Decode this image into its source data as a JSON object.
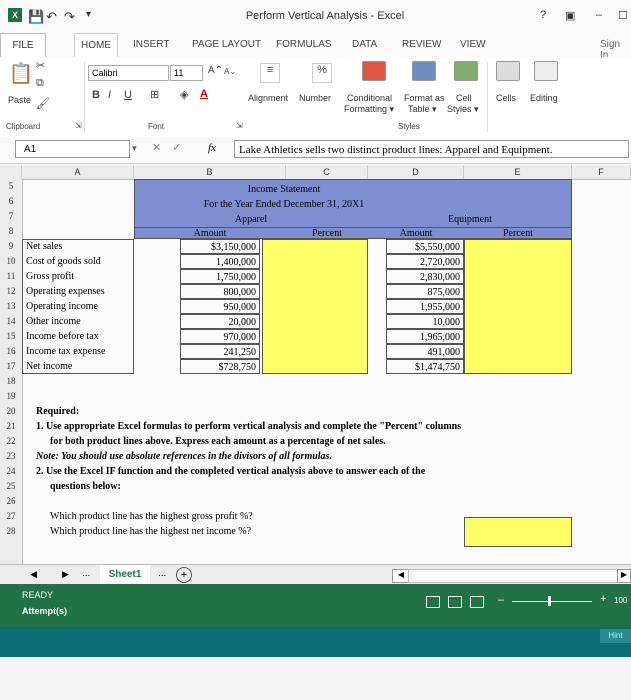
{
  "window": {
    "title": "Perform Vertical Analysis - Excel",
    "help": "?",
    "restore": "▣",
    "minimize": "–",
    "close": "✕"
  },
  "tabs": {
    "file": "FILE",
    "home": "HOME",
    "insert": "INSERT",
    "page_layout": "PAGE LAYOUT",
    "formulas": "FORMULAS",
    "data": "DATA",
    "review": "REVIEW",
    "view": "VIEW",
    "sign_in": "Sign In"
  },
  "ribbon": {
    "paste": "Paste",
    "font_name": "Calibri",
    "font_size": "11",
    "bold": "B",
    "italic": "I",
    "underline": "U",
    "alignment": "Alignment",
    "number": "Number",
    "percent": "%",
    "conditional": "Conditional",
    "formatting": "Formatting ▾",
    "format_as": "Format as",
    "table": "Table ▾",
    "cell": "Cell",
    "styles_btn": "Styles ▾",
    "cells": "Cells",
    "editing": "Editing",
    "groups": {
      "clipboard": "Clipboard",
      "font": "Font",
      "styles": "Styles"
    }
  },
  "formula_bar": {
    "name_box": "A1",
    "fx": "fx",
    "content": "Lake Athletics sells two distinct product lines: Apparel and Equipment."
  },
  "columns": [
    "A",
    "B",
    "C",
    "D",
    "E",
    "F"
  ],
  "rows": [
    "5",
    "6",
    "7",
    "8",
    "9",
    "10",
    "11",
    "12",
    "13",
    "14",
    "15",
    "16",
    "17",
    "18",
    "19",
    "20",
    "21",
    "22",
    "23",
    "24",
    "25",
    "26",
    "27",
    "28"
  ],
  "statement": {
    "title": "Income Statement",
    "period": "For the Year Ended December 31, 20X1",
    "apparel": "Apparel",
    "equipment": "Equipment",
    "amount": "Amount",
    "percent": "Percent",
    "lines": [
      {
        "label": "Net sales",
        "apparel": "$3,150,000",
        "equipment": "$5,550,000"
      },
      {
        "label": "Cost of goods sold",
        "apparel": "1,400,000",
        "equipment": "2,720,000"
      },
      {
        "label": "Gross profit",
        "apparel": "1,750,000",
        "equipment": "2,830,000"
      },
      {
        "label": "Operating expenses",
        "apparel": "800,000",
        "equipment": "875,000"
      },
      {
        "label": "Operating income",
        "apparel": "950,000",
        "equipment": "1,955,000"
      },
      {
        "label": "Other income",
        "apparel": "20,000",
        "equipment": "10,000"
      },
      {
        "label": "Income before tax",
        "apparel": "970,000",
        "equipment": "1,965,000"
      },
      {
        "label": "Income tax expense",
        "apparel": "241,250",
        "equipment": "491,000"
      },
      {
        "label": "Net income",
        "apparel": "$728,750",
        "equipment": "$1,474,750"
      }
    ]
  },
  "instructions": {
    "required": "Required:",
    "item1": "1. Use appropriate Excel formulas to perform vertical analysis and complete the \"Percent\" columns",
    "item1b": "for both product lines above. Express each amount as a percentage of net sales.",
    "note": "Note:  You should use absolute references in the divisors of all formulas.",
    "item2": "2. Use the Excel IF function and the completed vertical analysis above to answer each of the",
    "item2b": "questions below:",
    "q1": "Which product line has the highest gross profit %?",
    "q2": "Which product line has the highest net income %?"
  },
  "sheet_tabs": {
    "dots_left": "...",
    "active": "Sheet1",
    "dots_right": "...",
    "add": "+"
  },
  "status": {
    "ready": "READY",
    "attempts": "Attempt(s)",
    "zoom": "100",
    "hint": "Hint"
  },
  "colors": {
    "header_blue": "#7d8fd1",
    "input_yellow": "#ffff66",
    "status_green": "#217346",
    "bar_teal": "#0b6d73"
  }
}
